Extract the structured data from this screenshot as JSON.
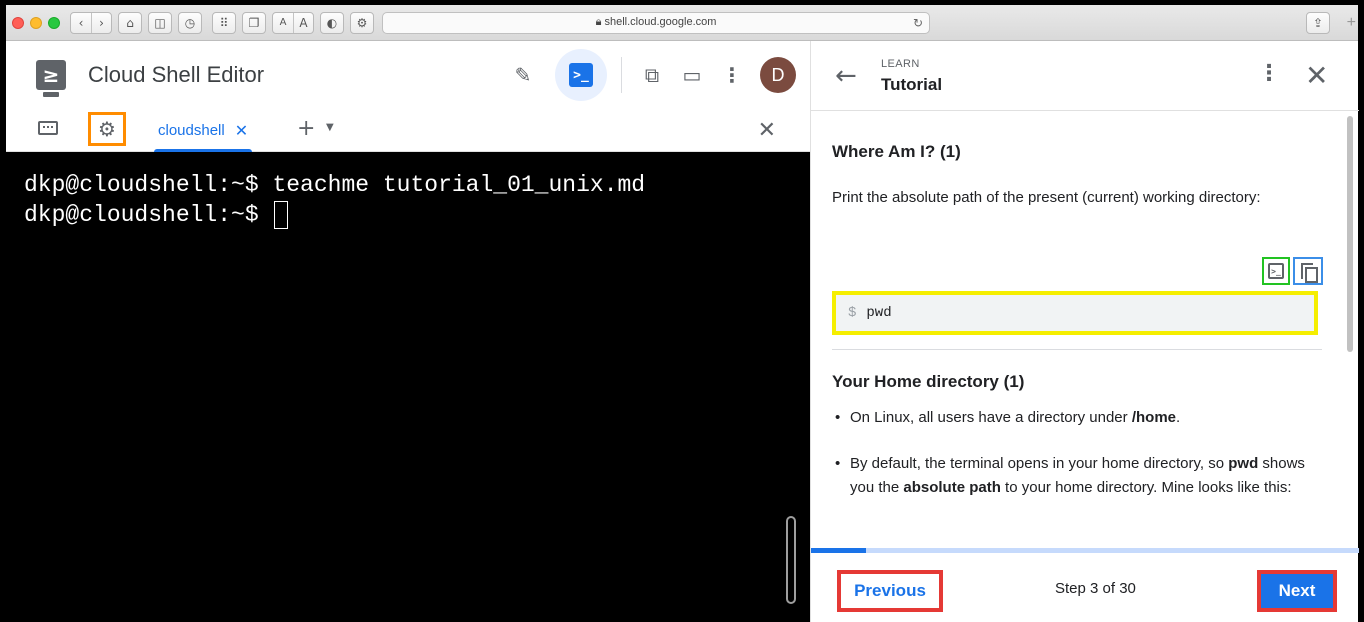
{
  "browser": {
    "url": "shell.cloud.google.com",
    "text_size_small": "A",
    "text_size_large": "A"
  },
  "editor": {
    "title": "Cloud Shell Editor",
    "avatar_initial": "D",
    "active_tab": "cloudshell",
    "terminal_lines": [
      "dkp@cloudshell:~$ teachme tutorial_01_unix.md",
      "dkp@cloudshell:~$ "
    ]
  },
  "tutorial": {
    "section": "LEARN",
    "title": "Tutorial",
    "heading1": "Where Am I? (1)",
    "para1": "Print the absolute path of the present (current) working directory:",
    "code_prompt": "$",
    "code_cmd": "pwd",
    "heading2": "Your Home directory (1)",
    "bullet1_pre": "On Linux, all users have a directory under ",
    "bullet1_bold": "/home",
    "bullet1_post": ".",
    "bullet2_bold1": "pwd",
    "bullet2_mid1": " shows you the ",
    "bullet2_bold2": "absolute path",
    "bullet2_post": " to your home directory. Mine looks like this:",
    "bullet2_pre": "By default, the terminal opens in your home directory, so ",
    "progress_fraction": 0.1,
    "previous_label": "Previous",
    "step_text": "Step 3 of 30",
    "next_label": "Next"
  },
  "colors": {
    "accent": "#1a73e8",
    "highlight_gear": "#ff8c00",
    "highlight_code": "#f5ee00",
    "highlight_run": "#22c322",
    "highlight_copy": "#3b8ee8",
    "highlight_nav": "#e53935"
  },
  "icons": {
    "gear": "gear-icon",
    "keyboard": "keyboard-icon",
    "pencil": "pencil-icon",
    "terminal": "terminal-icon",
    "preview": "preview-icon",
    "layout": "layout-icon",
    "more": "more-vert-icon",
    "back": "arrow-back-icon",
    "close": "close-icon",
    "copy": "copy-icon",
    "run": "run-in-terminal-icon"
  }
}
